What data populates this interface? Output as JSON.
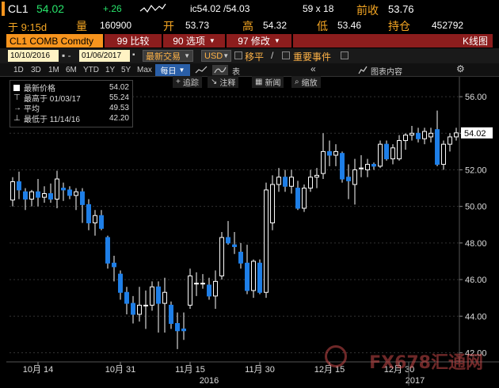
{
  "header": {
    "ticker": "CL1",
    "last": "54.02",
    "change": "+.26",
    "ic_label": "ic54.02 /54.03",
    "size": "59 x 18",
    "prev_close_label": "前收",
    "prev_close": "53.76",
    "time": "于 9:15d",
    "volume_label": "量",
    "volume": "160900",
    "open_label": "开",
    "open": "53.73",
    "high_label": "高",
    "high": "54.32",
    "low_label": "低",
    "low": "53.46",
    "oi_label": "持仓",
    "oi": "452792"
  },
  "toolbar": {
    "security": "CL1 COMB Comdty",
    "compare": "99 比较",
    "options": "90 选项",
    "edit": "97 修改",
    "chart_type": "K线图"
  },
  "range": {
    "start": "10/10/2016",
    "end": "01/06/2017",
    "field": "最新交易",
    "currency": "USD",
    "smooth": "移平",
    "events": "重要事件"
  },
  "timeframes": [
    "1D",
    "3D",
    "1M",
    "6M",
    "YTD",
    "1Y",
    "5Y",
    "Max"
  ],
  "period": "每日",
  "table_label": "表",
  "chart_contents": "图表内容",
  "tools": {
    "track": "追踪",
    "annotate": "注释",
    "news": "新闻",
    "zoom": "缩放"
  },
  "legend": [
    {
      "label": "最新价格",
      "value": "54.02"
    },
    {
      "label": "最高于 01/03/17",
      "value": "55.24"
    },
    {
      "label": "平均",
      "value": "49.53"
    },
    {
      "label": "最低于 11/14/16",
      "value": "42.20"
    }
  ],
  "watermark": "FX678汇通网",
  "colors": {
    "up": "#ffffff",
    "down": "#1e7fe8",
    "accent": "#f7941d",
    "price_tag": "#ffffff"
  },
  "chart_data": {
    "type": "candlestick",
    "ylim": [
      41.5,
      57.0
    ],
    "yticks": [
      "56.00",
      "54.00",
      "52.00",
      "50.00",
      "48.00",
      "46.00",
      "44.00",
      "42.00"
    ],
    "ytick_values": [
      56,
      54,
      52,
      50,
      48,
      46,
      44,
      42
    ],
    "last_price": "54.02",
    "xlabels": [
      "10月 14",
      "10月 31",
      "11月 15",
      "11月 30",
      "12月 15",
      "12月 30"
    ],
    "xlabel_index": [
      4,
      17,
      28,
      39,
      50,
      61
    ],
    "years": [
      {
        "label": "2016",
        "index": 31
      },
      {
        "label": "2017",
        "index": 63.5
      }
    ],
    "ohlc": [
      [
        50.35,
        51.6,
        50.0,
        51.35
      ],
      [
        51.35,
        51.9,
        50.4,
        50.9
      ],
      [
        50.8,
        51.0,
        49.8,
        50.4
      ],
      [
        50.4,
        50.9,
        50.0,
        50.8
      ],
      [
        50.8,
        51.5,
        50.0,
        50.5
      ],
      [
        50.5,
        51.1,
        50.2,
        50.7
      ],
      [
        50.7,
        51.25,
        50.2,
        50.4
      ],
      [
        50.4,
        51.95,
        49.9,
        51.5
      ],
      [
        51.0,
        51.3,
        50.3,
        50.9
      ],
      [
        50.9,
        51.1,
        50.4,
        50.6
      ],
      [
        50.6,
        51.0,
        49.8,
        50.8
      ],
      [
        50.8,
        51.0,
        49.1,
        50.1
      ],
      [
        50.1,
        50.4,
        48.7,
        49.1
      ],
      [
        49.1,
        49.8,
        48.4,
        49.5
      ],
      [
        49.5,
        49.8,
        48.7,
        48.8
      ],
      [
        48.3,
        48.4,
        46.6,
        46.9
      ],
      [
        46.9,
        47.3,
        45.9,
        46.7
      ],
      [
        46.3,
        46.5,
        44.9,
        45.3
      ],
      [
        45.3,
        45.6,
        44.1,
        44.7
      ],
      [
        44.7,
        45.1,
        43.6,
        44.1
      ],
      [
        44.1,
        45.6,
        43.7,
        44.6
      ],
      [
        44.6,
        45.4,
        43.3,
        44.6
      ],
      [
        44.6,
        45.9,
        44.3,
        45.6
      ],
      [
        45.6,
        45.9,
        43.1,
        44.7
      ],
      [
        44.7,
        46.1,
        43.1,
        45.3
      ],
      [
        44.6,
        44.8,
        43.3,
        43.6
      ],
      [
        43.6,
        44.2,
        42.2,
        43.2
      ],
      [
        43.3,
        44.2,
        42.7,
        43.2
      ],
      [
        44.6,
        46.6,
        44.4,
        46.2
      ],
      [
        45.8,
        46.4,
        45.1,
        45.8
      ],
      [
        45.8,
        46.3,
        45.5,
        45.8
      ],
      [
        45.7,
        46.1,
        44.9,
        45.1
      ],
      [
        45.1,
        46.5,
        44.4,
        45.9
      ],
      [
        46.2,
        48.6,
        46.0,
        48.3
      ],
      [
        48.3,
        49.2,
        47.9,
        48.0
      ],
      [
        47.9,
        48.6,
        47.4,
        47.8
      ],
      [
        47.5,
        48.0,
        46.6,
        46.9
      ],
      [
        46.9,
        47.9,
        45.2,
        45.4
      ],
      [
        45.4,
        47.1,
        45.0,
        47.0
      ],
      [
        46.9,
        47.1,
        45.2,
        45.3
      ],
      [
        45.3,
        51.3,
        45.0,
        50.9
      ],
      [
        49.1,
        51.7,
        48.7,
        51.2
      ],
      [
        51.2,
        52.1,
        50.8,
        51.6
      ],
      [
        51.6,
        52.0,
        50.8,
        51.1
      ],
      [
        51.1,
        52.0,
        50.7,
        51.6
      ],
      [
        51.0,
        51.4,
        49.8,
        49.9
      ],
      [
        49.9,
        51.2,
        49.7,
        51.0
      ],
      [
        51.0,
        52.0,
        50.8,
        51.6
      ],
      [
        51.6,
        52.1,
        51.0,
        51.7
      ],
      [
        51.8,
        54.0,
        51.5,
        53.0
      ],
      [
        53.0,
        53.6,
        52.2,
        52.8
      ],
      [
        52.8,
        53.4,
        52.2,
        53.0
      ],
      [
        52.9,
        53.0,
        51.3,
        51.5
      ],
      [
        51.6,
        52.3,
        50.4,
        51.4
      ],
      [
        51.2,
        52.6,
        50.1,
        52.0
      ],
      [
        52.1,
        52.8,
        51.6,
        52.1
      ],
      [
        52.0,
        52.6,
        51.6,
        52.3
      ],
      [
        52.3,
        52.4,
        52.0,
        52.2
      ],
      [
        52.2,
        53.6,
        52.1,
        53.4
      ],
      [
        53.4,
        53.6,
        52.5,
        52.6
      ],
      [
        52.6,
        53.4,
        52.3,
        53.2
      ],
      [
        52.6,
        53.9,
        52.5,
        53.6
      ],
      [
        53.6,
        54.0,
        53.1,
        53.9
      ],
      [
        53.9,
        54.4,
        53.6,
        54.0
      ],
      [
        54.0,
        54.3,
        53.5,
        53.7
      ],
      [
        53.7,
        54.3,
        53.4,
        54.1
      ],
      [
        53.8,
        54.3,
        53.5,
        54.0
      ],
      [
        54.2,
        55.24,
        52.2,
        52.3
      ],
      [
        52.3,
        53.6,
        52.0,
        53.4
      ],
      [
        53.4,
        54.0,
        53.0,
        53.8
      ],
      [
        53.8,
        54.3,
        53.6,
        54.02
      ]
    ]
  }
}
